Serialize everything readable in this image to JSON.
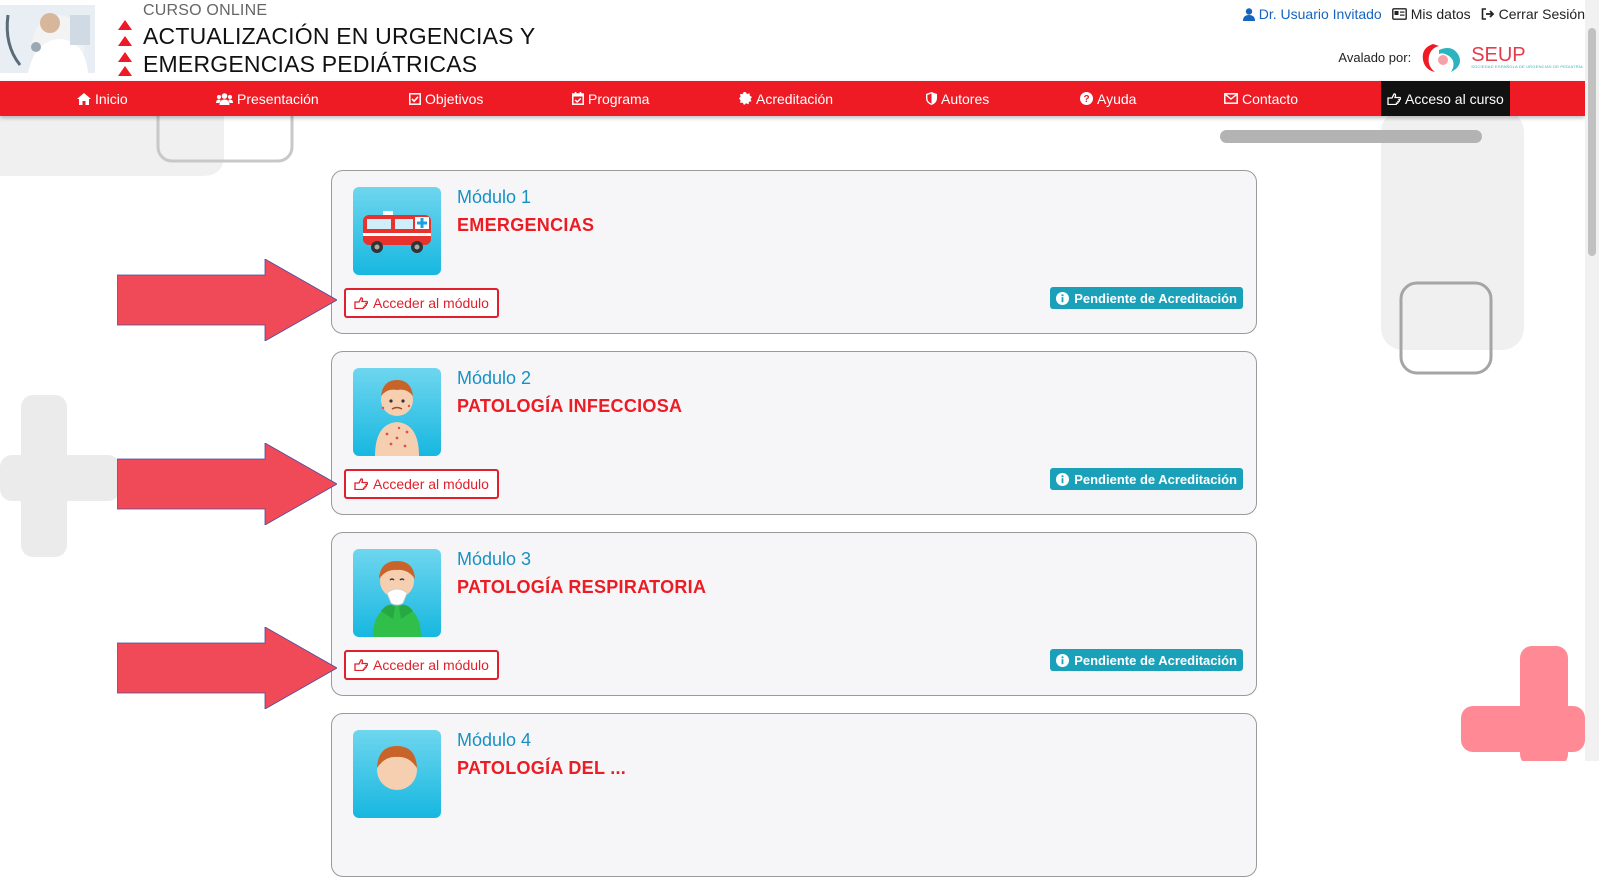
{
  "header": {
    "course_label": "CURSO ONLINE",
    "title_line1": "ACTUALIZACIÓN EN URGENCIAS Y",
    "title_line2": "EMERGENCIAS PEDIÁTRICAS",
    "user_name": "Dr. Usuario Invitado",
    "my_data": "Mis datos",
    "logout": "Cerrar Sesión",
    "endorsed_by": "Avalado por:",
    "seup_logo_text": "SEUP",
    "seup_logo_subtext": "SOCIEDAD ESPAÑOLA DE URGENCIAS DE PEDIATRÍA"
  },
  "nav": {
    "items": [
      {
        "label": "Inicio",
        "icon": "home-icon"
      },
      {
        "label": "Presentación",
        "icon": "users-icon"
      },
      {
        "label": "Objetivos",
        "icon": "checkbox-icon"
      },
      {
        "label": "Programa",
        "icon": "calendar-check-icon"
      },
      {
        "label": "Acreditación",
        "icon": "certificate-icon"
      },
      {
        "label": "Autores",
        "icon": "shield-icon"
      },
      {
        "label": "Ayuda",
        "icon": "question-circle-icon"
      },
      {
        "label": "Contacto",
        "icon": "envelope-icon"
      },
      {
        "label": "Acceso al curso",
        "icon": "hand-point-icon"
      }
    ]
  },
  "modules": [
    {
      "number": "Módulo 1",
      "name": "EMERGENCIAS",
      "button": "Acceder al módulo",
      "status": "Pendiente de Acreditación",
      "image_icon": "ambulance-icon"
    },
    {
      "number": "Módulo 2",
      "name": "PATOLOGÍA INFECCIOSA",
      "button": "Acceder al módulo",
      "status": "Pendiente de Acreditación",
      "image_icon": "child-rash-icon"
    },
    {
      "number": "Módulo 3",
      "name": "PATOLOGÍA RESPIRATORIA",
      "button": "Acceder al módulo",
      "status": "Pendiente de Acreditación",
      "image_icon": "child-sneezing-icon"
    },
    {
      "number": "Módulo 4",
      "name": "PATOLOGÍA DEL ...",
      "image_icon": "child-icon"
    }
  ],
  "colors": {
    "brand_red": "#ee1b24",
    "module_title_blue": "#1591c4",
    "badge_teal": "#1aa1b9",
    "annotation_arrow": "#f04a58"
  }
}
